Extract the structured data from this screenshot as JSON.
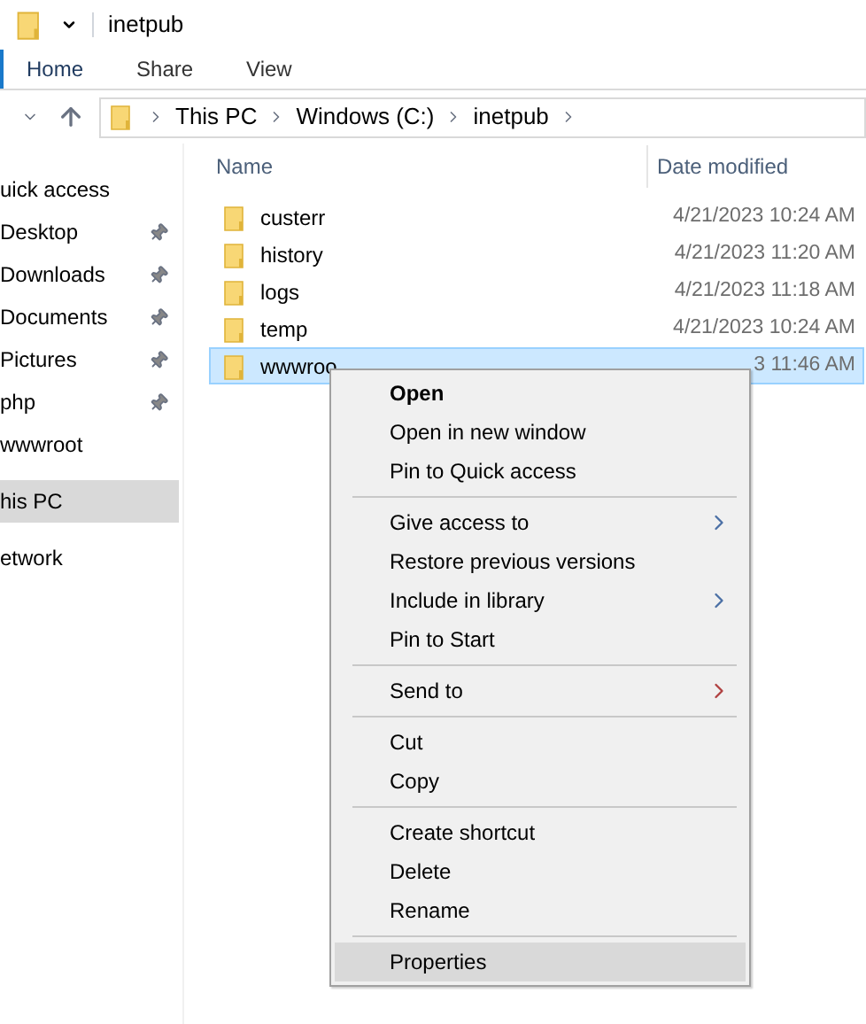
{
  "window": {
    "title": "inetpub"
  },
  "ribbon_tabs": [
    {
      "label": "Home",
      "selected": true
    },
    {
      "label": "Share",
      "selected": false
    },
    {
      "label": "View",
      "selected": false
    }
  ],
  "breadcrumb": [
    "This PC",
    "Windows (C:)",
    "inetpub"
  ],
  "sidebar": {
    "items": [
      {
        "label": "uick access",
        "pinned": false,
        "selected": false
      },
      {
        "label": "Desktop",
        "pinned": true,
        "selected": false
      },
      {
        "label": "Downloads",
        "pinned": true,
        "selected": false
      },
      {
        "label": "Documents",
        "pinned": true,
        "selected": false
      },
      {
        "label": "Pictures",
        "pinned": true,
        "selected": false
      },
      {
        "label": "php",
        "pinned": true,
        "selected": false
      },
      {
        "label": "wwwroot",
        "pinned": false,
        "selected": false
      },
      {
        "label": "his PC",
        "pinned": false,
        "selected": true,
        "gap": true
      },
      {
        "label": "etwork",
        "pinned": false,
        "selected": false,
        "gap": true
      }
    ]
  },
  "table": {
    "columns": [
      "Name",
      "Date modified"
    ],
    "rows": [
      {
        "name": "custerr",
        "date": "4/21/2023 10:24 AM",
        "selected": false
      },
      {
        "name": "history",
        "date": "4/21/2023 11:20 AM",
        "selected": false
      },
      {
        "name": "logs",
        "date": "4/21/2023 11:18 AM",
        "selected": false
      },
      {
        "name": "temp",
        "date": "4/21/2023 10:24 AM",
        "selected": false
      },
      {
        "name": "wwwroo",
        "date": "3 11:46 AM",
        "selected": true
      }
    ]
  },
  "context_menu": {
    "groups": [
      [
        {
          "label": "Open",
          "bold": true,
          "submenu": false,
          "highlighted": false
        },
        {
          "label": "Open in new window",
          "bold": false,
          "submenu": false,
          "highlighted": false
        },
        {
          "label": "Pin to Quick access",
          "bold": false,
          "submenu": false,
          "highlighted": false
        }
      ],
      [
        {
          "label": "Give access to",
          "bold": false,
          "submenu": true,
          "highlighted": false
        },
        {
          "label": "Restore previous versions",
          "bold": false,
          "submenu": false,
          "highlighted": false
        },
        {
          "label": "Include in library",
          "bold": false,
          "submenu": true,
          "highlighted": false
        },
        {
          "label": "Pin to Start",
          "bold": false,
          "submenu": false,
          "highlighted": false
        }
      ],
      [
        {
          "label": "Send to",
          "bold": false,
          "submenu": true,
          "highlighted": false
        }
      ],
      [
        {
          "label": "Cut",
          "bold": false,
          "submenu": false,
          "highlighted": false
        },
        {
          "label": "Copy",
          "bold": false,
          "submenu": false,
          "highlighted": false
        }
      ],
      [
        {
          "label": "Create shortcut",
          "bold": false,
          "submenu": false,
          "highlighted": false
        },
        {
          "label": "Delete",
          "bold": false,
          "submenu": false,
          "highlighted": false
        },
        {
          "label": "Rename",
          "bold": false,
          "submenu": false,
          "highlighted": false
        }
      ],
      [
        {
          "label": "Properties",
          "bold": false,
          "submenu": false,
          "highlighted": true
        }
      ]
    ]
  }
}
